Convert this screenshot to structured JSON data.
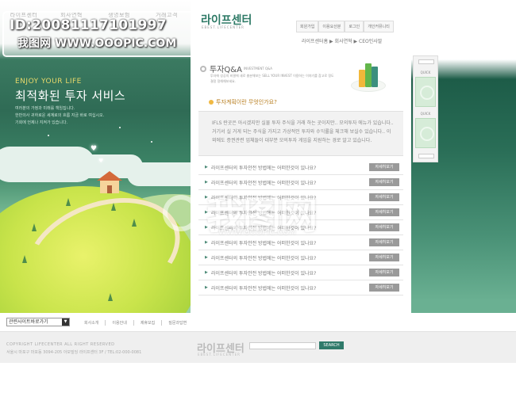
{
  "watermark": {
    "id_line": "ID:20081117101997",
    "site_line": "我图网  WWW.OOOPIC.COM",
    "center_big": "我图网",
    "center_url": "WWW.OOOPIC.COM"
  },
  "topnav": {
    "items": [
      "라이프센터",
      "회사연혁",
      "생명보험",
      "거래고객"
    ]
  },
  "hero": {
    "subtitle": "ENJOY YOUR LIFE",
    "title": "최적화된 투자 서비스",
    "desc": [
      "여러분의 가정과 미래를 책임집니다.",
      "한반의사 귀하로운 세계로의 흐름 지금 바로 여십시오.",
      "기회에 언제나 지켜가 있습니다."
    ]
  },
  "header": {
    "brand": "라이프센터",
    "brand_sub": "EBEST.LIFECENTER",
    "utils": [
      "회원가입",
      "이용요산분",
      "로그인",
      "개인커뮤니티"
    ],
    "breadcrumb": "라이프센터홈 ▶ 회사연혁 ▶ CEO인사말"
  },
  "section": {
    "title": "투자Q&A",
    "title_en": "INVESTMENT Q&A",
    "intro": "투자에 성공의 비결에 새로 충분해보는 SELL YOUR INVEST 이용하는 이야기를 참고로 정도 결정 정해해보세요.",
    "question": "투자계획이란 무엇인가요?",
    "answer": "IFLS 란곳은 아시겠지만 실물 투자 주식을 거래 하는 곳이지만.. 모의투자 에뉴가 있습니다.. 거기서 실 거게 되는 주식을 가지고 가상적인 투자와 수익률을 체크해 보실수 있습니다.. 이외에도 증권관련 업체들이 대부분 모의투자 게임을 지원하는 경로 알고 있습니다."
  },
  "questions": [
    {
      "text": "라이프센터의 투자안전 방법에는 어떠한것이 있나요?",
      "more": "자세히보기"
    },
    {
      "text": "라이프센터의 투자안전 방법에는 어떠한것이 있나요?",
      "more": "자세히보기"
    },
    {
      "text": "라이프센터의 투자안전 방법에는 어떠한것이 있나요?",
      "more": "자세히보기"
    },
    {
      "text": "라이프센터의 투자안전 방법에는 어떠한것이 있나요?",
      "more": "자세히보기"
    },
    {
      "text": "라이프센터의 투자안전 방법에는 어떠한것이 있나요?",
      "more": "자세히보기"
    },
    {
      "text": "라이프센터의 투자안전 방법에는 어떠한것이 있나요?",
      "more": "자세히보기"
    },
    {
      "text": "라이프센터의 투자안전 방법에는 어떠한것이 있나요?",
      "more": "자세히보기"
    },
    {
      "text": "라이프센터의 투자안전 방법에는 어떠한것이 있나요?",
      "more": "자세히보기"
    },
    {
      "text": "라이프센터의 투자안전 방법에는 어떠한것이 있나요?",
      "more": "자세히보기"
    }
  ],
  "quick": {
    "label": "QUICK"
  },
  "footer": {
    "shortcut": "관련사이트바로가기",
    "links": [
      "회사소개",
      "이용안내",
      "제휴모집",
      "질문과답변"
    ],
    "copyright": "COPYRIGHT LIFECENTER ALL RIGHT RESERVED",
    "address": "서울시 마포구 마포동 3094-205 아모빌딩 라이프센터 3F  /  TEL:02-000-0081",
    "brand": "라이프센터",
    "brand_sub": "EBEST.LIFECENTER",
    "search_label": "SEARCH"
  }
}
